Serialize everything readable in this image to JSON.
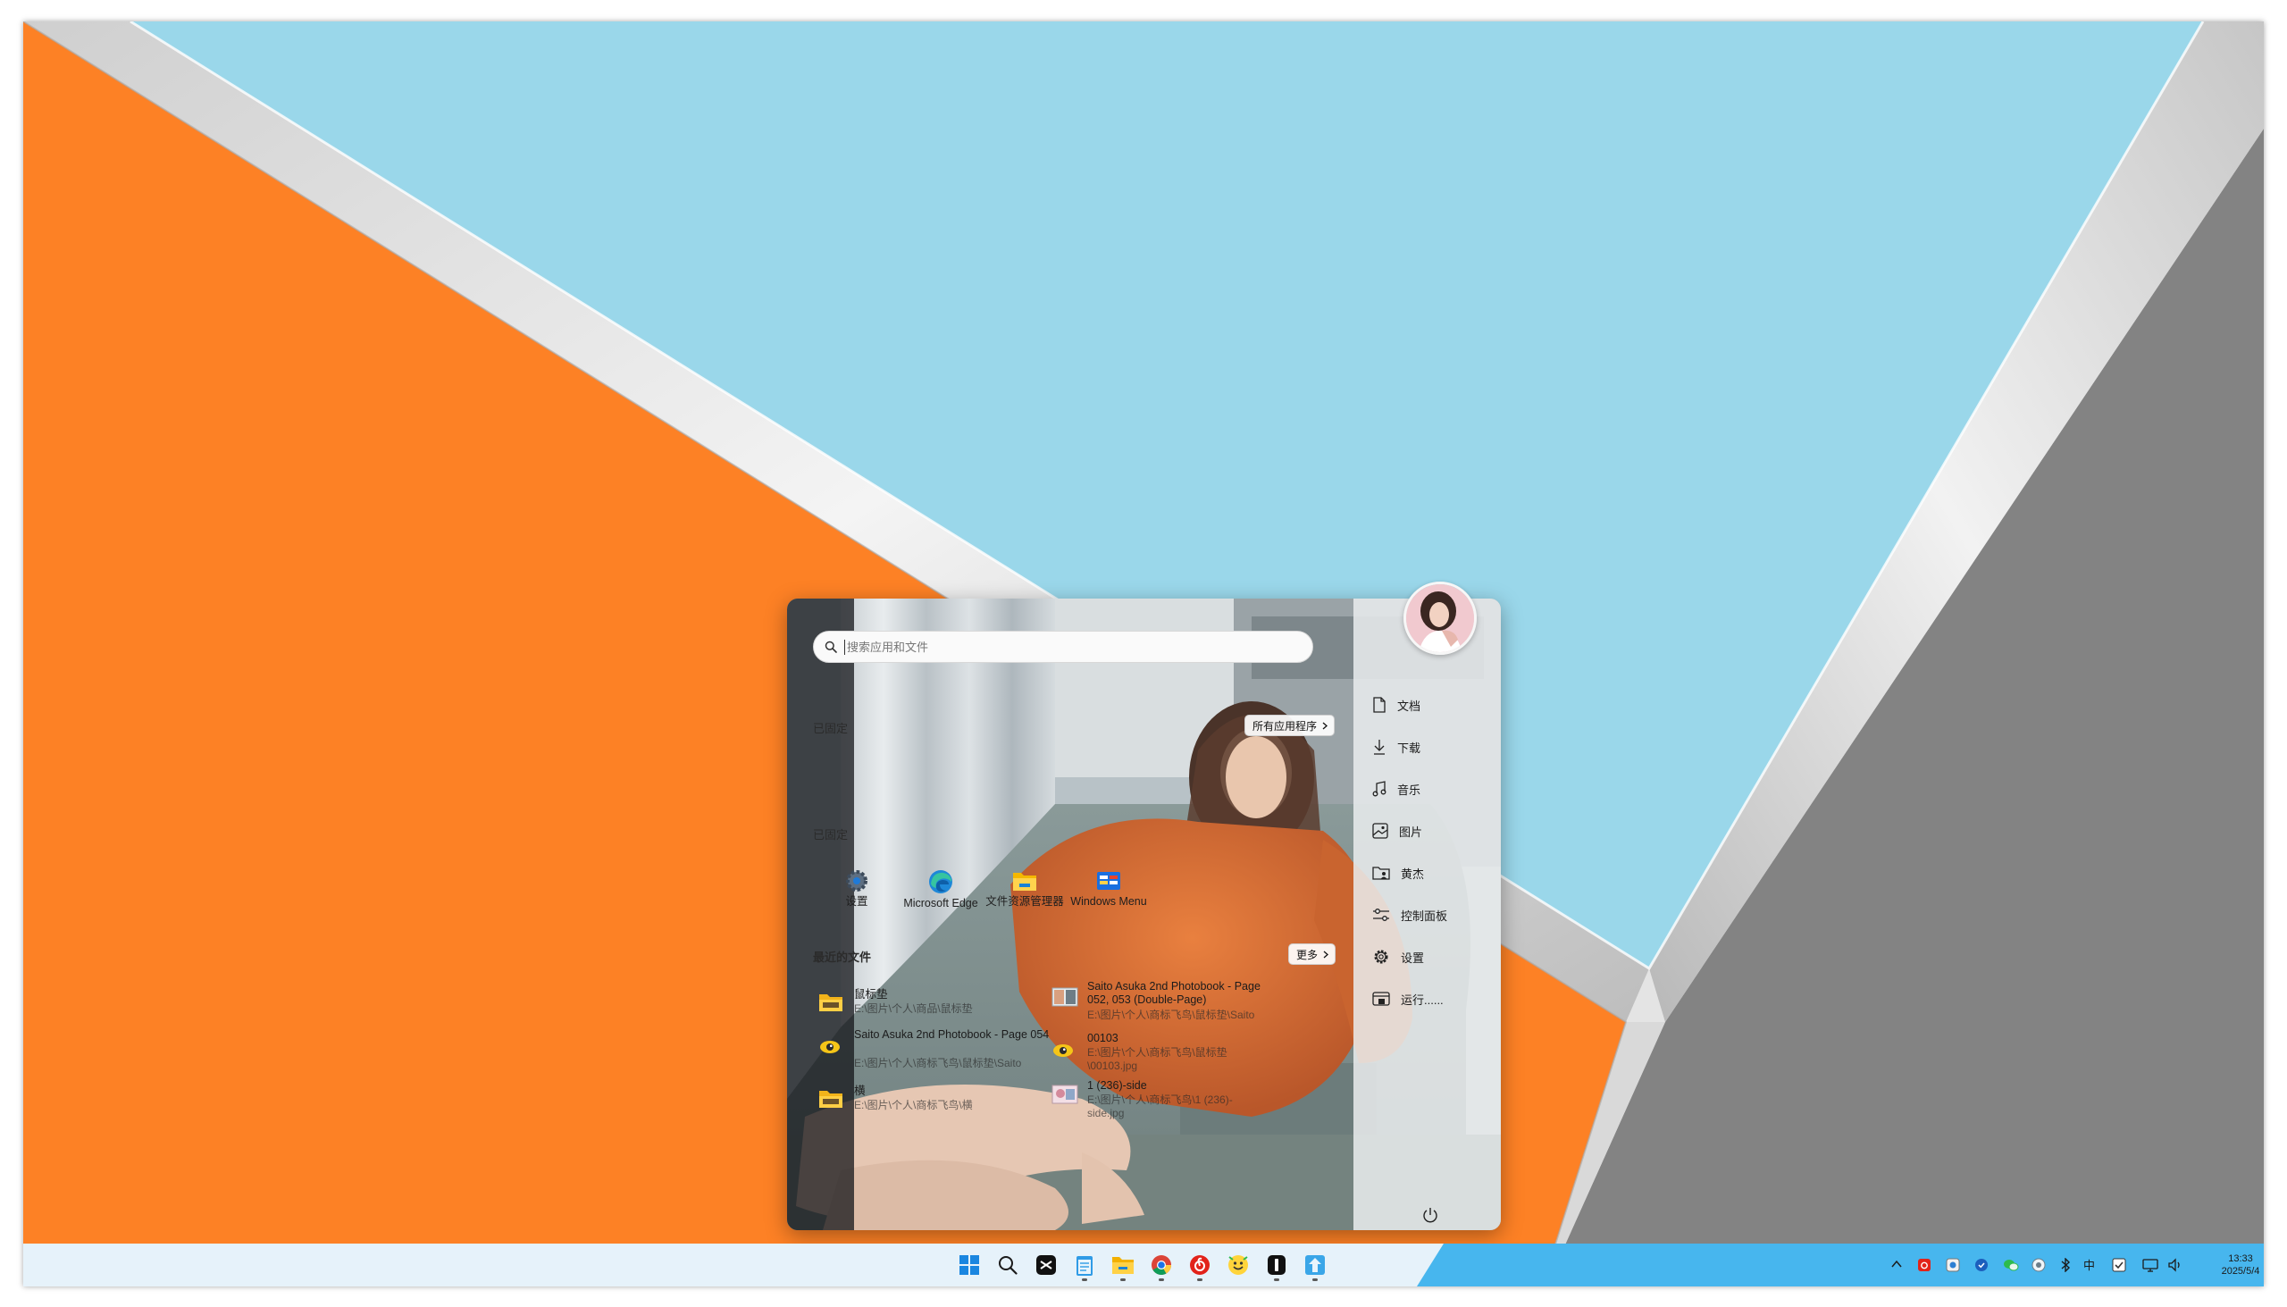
{
  "colors": {
    "wallpaper_orange": "#fd8125",
    "wallpaper_blue": "#9ad7ea",
    "wallpaper_gray": "#838383",
    "wallpaper_band": "#dcdcdc",
    "taskbar_light": "#e6f2fa",
    "taskbar_accent": "#47b6ee"
  },
  "start_menu": {
    "search": {
      "placeholder": "搜索应用和文件",
      "icon": "search-icon"
    },
    "pinned_label_1": "已固定",
    "pinned_label_2": "已固定",
    "all_apps_button": "所有应用程序",
    "pinned_apps": [
      {
        "label": "设置",
        "icon": "settings-gear-icon"
      },
      {
        "label": "Microsoft Edge",
        "icon": "edge-icon"
      },
      {
        "label": "文件资源管理器",
        "icon": "folder-icon"
      },
      {
        "label": "Windows Menu",
        "icon": "windows-menu-icon"
      }
    ],
    "recent_label": "最近的文件",
    "more_button": "更多",
    "recent_files": [
      {
        "name": "鼠标垫",
        "path": "E:\\图片\\个人\\商品\\鼠标垫",
        "icon": "folder-icon"
      },
      {
        "name": "Saito Asuka 2nd Photobook - Page 054",
        "path": "E:\\图片\\个人\\商标飞鸟\\鼠标垫\\Saito",
        "icon": "image-viewer-icon"
      },
      {
        "name": "横",
        "path": "E:\\图片\\个人\\商标飞鸟\\横",
        "icon": "folder-icon"
      },
      {
        "name": "Saito Asuka 2nd Photobook - Page 052, 053 (Double-Page)",
        "path": "E:\\图片\\个人\\商标飞鸟\\鼠标垫\\Saito",
        "icon": "image-file-icon"
      },
      {
        "name": "00103",
        "path": "E:\\图片\\个人\\商标飞鸟\\鼠标垫\\00103.jpg",
        "icon": "image-viewer-icon"
      },
      {
        "name": "1 (236)-side",
        "path": "E:\\图片\\个人\\商标飞鸟\\1 (236)-side.jpg",
        "icon": "image-file-icon"
      }
    ],
    "quick_links": [
      {
        "label": "文档",
        "icon": "document-icon"
      },
      {
        "label": "下载",
        "icon": "download-icon"
      },
      {
        "label": "音乐",
        "icon": "music-icon"
      },
      {
        "label": "图片",
        "icon": "pictures-icon"
      },
      {
        "label": "黄杰",
        "icon": "user-folder-icon"
      },
      {
        "label": "控制面板",
        "icon": "control-panel-icon"
      },
      {
        "label": "设置",
        "icon": "settings-icon"
      },
      {
        "label": "运行......",
        "icon": "run-icon"
      }
    ],
    "power_icon": "power-icon"
  },
  "taskbar": {
    "apps": [
      "windows-start-icon",
      "search-icon",
      "capcut-icon",
      "notepad-icon",
      "file-explorer-icon",
      "chrome-icon",
      "netease-music-icon",
      "wechat-icon",
      "black-app-icon",
      "store-app-icon"
    ],
    "tray_icons": [
      "chevron-up-icon",
      "netease-tray-icon",
      "app-tray-icon",
      "shield-tray-icon",
      "wechat-tray-icon",
      "cloud-tray-icon",
      "bluetooth-icon",
      "ime-icon",
      "checkbox-tray-icon",
      "network-icon",
      "volume-icon"
    ],
    "ime_label": "中",
    "time": "13:33",
    "date": "2025/5/4"
  }
}
